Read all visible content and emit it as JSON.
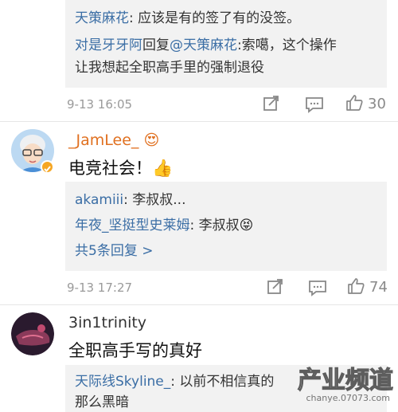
{
  "thread1": {
    "replies": [
      {
        "user": "天策麻花",
        "sep": ": ",
        "text": "应该是有的签了有的没签。"
      }
    ],
    "reply2": {
      "user": "对是牙牙阿",
      "mid": "回复",
      "target": "@天策麻花",
      "text": ":索噶，这个操作",
      "text2": "让我想起全职高手里的强制退役"
    },
    "time": "9-13 16:05",
    "like_count": "30"
  },
  "comment1": {
    "author": "_JamLee_",
    "author_emoji": "😍",
    "text": "电竞社会！",
    "text_emoji": "👍",
    "replies": [
      {
        "user": "akamiii",
        "sep": ": ",
        "text": "李叔叔..."
      },
      {
        "user": "年夜_坚挺型史莱姆",
        "sep": ": ",
        "text": "李叔叔",
        "emoji": "😝"
      }
    ],
    "more": "共5条回复 >",
    "time": "9-13 17:27",
    "like_count": "74"
  },
  "comment2": {
    "author": "3in1trinity",
    "text": "全职高手写的真好",
    "replies": [
      {
        "user": "天际线Skyline_",
        "sep": ": ",
        "text": "以前不相信真的",
        "text2": "那么黑暗"
      }
    ]
  },
  "watermark": {
    "main": "产业频道",
    "sub": "chanye.07073.com"
  },
  "colors": {
    "link": "#3b6ea5",
    "author": "#e07020",
    "meta": "#9a9a9a",
    "reply_bg": "#f2f2f2"
  }
}
